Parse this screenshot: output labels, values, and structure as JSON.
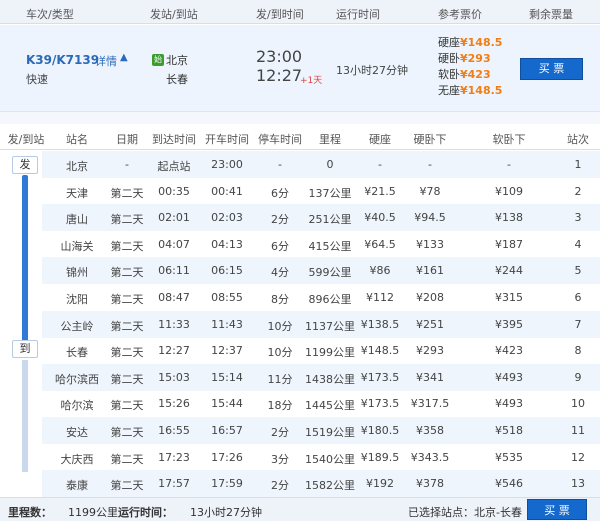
{
  "header": {
    "train_type": "车次/类型",
    "stations": "发站/到站",
    "times": "发/到时间",
    "duration": "运行时间",
    "fares": "参考票价",
    "remaining": "剩余票量"
  },
  "train": {
    "code": "K39/K7139",
    "detail_link": "详情",
    "type": "快速",
    "from_icon": "始",
    "from": "北京",
    "to": "长春",
    "depart": "23:00",
    "arrive": "12:27",
    "plus_day": "+1天",
    "duration": "13小时27分钟",
    "fares": [
      {
        "label": "硬座",
        "price": "¥148.5"
      },
      {
        "label": "硬卧",
        "price": "¥293"
      },
      {
        "label": "软卧",
        "price": "¥423"
      },
      {
        "label": "无座",
        "price": "¥148.5"
      }
    ],
    "buy_label": "买 票"
  },
  "columns": [
    "发/到站",
    "站名",
    "日期",
    "到达时间",
    "开车时间",
    "停车时间",
    "里程",
    "硬座",
    "硬卧下",
    "软卧下",
    "站次"
  ],
  "badges": {
    "depart": "发",
    "arrive": "到"
  },
  "stops": [
    [
      "北京",
      "-",
      "起点站",
      "23:00",
      "-",
      "0",
      "-",
      "-",
      "-",
      "1"
    ],
    [
      "天津",
      "第二天",
      "00:35",
      "00:41",
      "6分",
      "137公里",
      "¥21.5",
      "¥78",
      "¥109",
      "2"
    ],
    [
      "唐山",
      "第二天",
      "02:01",
      "02:03",
      "2分",
      "251公里",
      "¥40.5",
      "¥94.5",
      "¥138",
      "3"
    ],
    [
      "山海关",
      "第二天",
      "04:07",
      "04:13",
      "6分",
      "415公里",
      "¥64.5",
      "¥133",
      "¥187",
      "4"
    ],
    [
      "锦州",
      "第二天",
      "06:11",
      "06:15",
      "4分",
      "599公里",
      "¥86",
      "¥161",
      "¥244",
      "5"
    ],
    [
      "沈阳",
      "第二天",
      "08:47",
      "08:55",
      "8分",
      "896公里",
      "¥112",
      "¥208",
      "¥315",
      "6"
    ],
    [
      "公主岭",
      "第二天",
      "11:33",
      "11:43",
      "10分",
      "1137公里",
      "¥138.5",
      "¥251",
      "¥395",
      "7"
    ],
    [
      "长春",
      "第二天",
      "12:27",
      "12:37",
      "10分",
      "1199公里",
      "¥148.5",
      "¥293",
      "¥423",
      "8"
    ],
    [
      "哈尔滨西",
      "第二天",
      "15:03",
      "15:14",
      "11分",
      "1438公里",
      "¥173.5",
      "¥341",
      "¥493",
      "9"
    ],
    [
      "哈尔滨",
      "第二天",
      "15:26",
      "15:44",
      "18分",
      "1445公里",
      "¥173.5",
      "¥317.5",
      "¥493",
      "10"
    ],
    [
      "安达",
      "第二天",
      "16:55",
      "16:57",
      "2分",
      "1519公里",
      "¥180.5",
      "¥358",
      "¥518",
      "11"
    ],
    [
      "大庆西",
      "第二天",
      "17:23",
      "17:26",
      "3分",
      "1540公里",
      "¥189.5",
      "¥343.5",
      "¥535",
      "12"
    ],
    [
      "泰康",
      "第二天",
      "17:57",
      "17:59",
      "2分",
      "1582公里",
      "¥192",
      "¥378",
      "¥546",
      "13"
    ]
  ],
  "footer": {
    "distance_label": "里程数：",
    "distance": "1199公里",
    "runtime_label": "运行时间：",
    "runtime": "13小时27分钟",
    "selected": "已选择站点：北京-长春",
    "buy_label": "买 票"
  }
}
